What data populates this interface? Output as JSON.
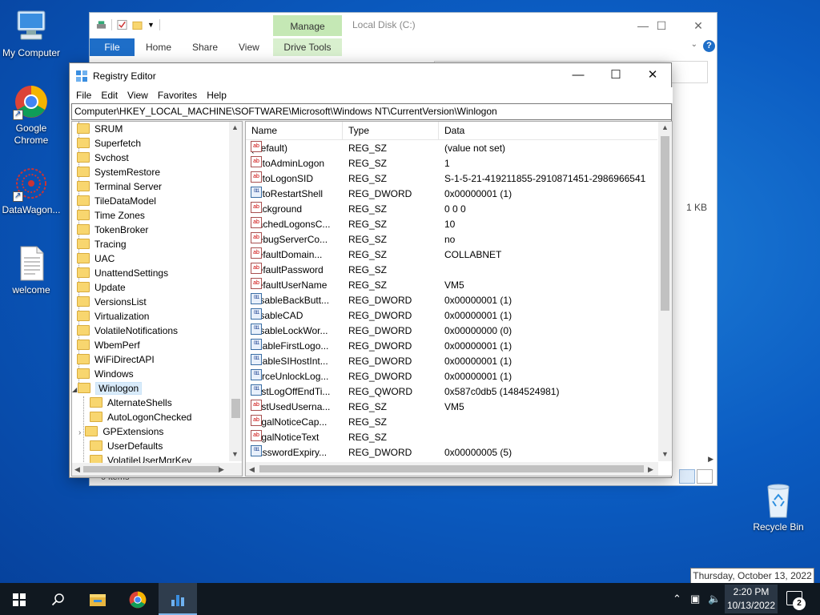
{
  "desktop": {
    "icons": [
      {
        "label": "My Computer"
      },
      {
        "label": "Google Chrome"
      },
      {
        "label": "DataWagon..."
      },
      {
        "label": "welcome"
      }
    ],
    "recycle_bin": "Recycle Bin"
  },
  "explorer": {
    "title": "Local Disk (C:)",
    "manage_tab": "Manage",
    "ribbon_tabs": [
      "File",
      "Home",
      "Share",
      "View",
      "Drive Tools"
    ],
    "size_text": "1 KB",
    "status_text": "0 items",
    "help": "?"
  },
  "regedit": {
    "title": "Registry Editor",
    "menu": [
      "File",
      "Edit",
      "View",
      "Favorites",
      "Help"
    ],
    "address": "Computer\\HKEY_LOCAL_MACHINE\\SOFTWARE\\Microsoft\\Windows NT\\CurrentVersion\\Winlogon",
    "tree": {
      "items": [
        "SRUM",
        "Superfetch",
        "Svchost",
        "SystemRestore",
        "Terminal Server",
        "TileDataModel",
        "Time Zones",
        "TokenBroker",
        "Tracing",
        "UAC",
        "UnattendSettings",
        "Update",
        "VersionsList",
        "Virtualization",
        "VolatileNotifications",
        "WbemPerf",
        "WiFiDirectAPI",
        "Windows",
        "Winlogon"
      ],
      "selected": "Winlogon",
      "children": [
        "AlternateShells",
        "AutoLogonChecked",
        "GPExtensions",
        "UserDefaults",
        "VolatileUserMgrKey"
      ]
    },
    "columns": [
      "Name",
      "Type",
      "Data"
    ],
    "values": [
      {
        "icon": "string",
        "name": "(Default)",
        "type": "REG_SZ",
        "data": "(value not set)"
      },
      {
        "icon": "string",
        "name": "AutoAdminLogon",
        "type": "REG_SZ",
        "data": "1"
      },
      {
        "icon": "string",
        "name": "AutoLogonSID",
        "type": "REG_SZ",
        "data": "S-1-5-21-419211855-2910871451-2986966541"
      },
      {
        "icon": "binary",
        "name": "AutoRestartShell",
        "type": "REG_DWORD",
        "data": "0x00000001 (1)"
      },
      {
        "icon": "string",
        "name": "Background",
        "type": "REG_SZ",
        "data": "0 0 0"
      },
      {
        "icon": "string",
        "name": "CachedLogonsC...",
        "type": "REG_SZ",
        "data": "10"
      },
      {
        "icon": "string",
        "name": "DebugServerCo...",
        "type": "REG_SZ",
        "data": "no"
      },
      {
        "icon": "string",
        "name": "DefaultDomain...",
        "type": "REG_SZ",
        "data": "COLLABNET"
      },
      {
        "icon": "string",
        "name": "DefaultPassword",
        "type": "REG_SZ",
        "data": ""
      },
      {
        "icon": "string",
        "name": "DefaultUserName",
        "type": "REG_SZ",
        "data": "VM5"
      },
      {
        "icon": "binary",
        "name": "DisableBackButt...",
        "type": "REG_DWORD",
        "data": "0x00000001 (1)"
      },
      {
        "icon": "binary",
        "name": "DisableCAD",
        "type": "REG_DWORD",
        "data": "0x00000001 (1)"
      },
      {
        "icon": "binary",
        "name": "DisableLockWor...",
        "type": "REG_DWORD",
        "data": "0x00000000 (0)"
      },
      {
        "icon": "binary",
        "name": "EnableFirstLogo...",
        "type": "REG_DWORD",
        "data": "0x00000001 (1)"
      },
      {
        "icon": "binary",
        "name": "EnableSIHostInt...",
        "type": "REG_DWORD",
        "data": "0x00000001 (1)"
      },
      {
        "icon": "binary",
        "name": "ForceUnlockLog...",
        "type": "REG_DWORD",
        "data": "0x00000001 (1)"
      },
      {
        "icon": "binary",
        "name": "LastLogOffEndTi...",
        "type": "REG_QWORD",
        "data": "0x587c0db5 (1484524981)"
      },
      {
        "icon": "string",
        "name": "LastUsedUserna...",
        "type": "REG_SZ",
        "data": "VM5"
      },
      {
        "icon": "string",
        "name": "LegalNoticeCap...",
        "type": "REG_SZ",
        "data": ""
      },
      {
        "icon": "string",
        "name": "LegalNoticeText",
        "type": "REG_SZ",
        "data": ""
      },
      {
        "icon": "binary",
        "name": "PasswordExpiry...",
        "type": "REG_DWORD",
        "data": "0x00000005 (5)"
      }
    ]
  },
  "tooltip": "Thursday, October 13, 2022",
  "taskbar": {
    "time": "2:20 PM",
    "date": "10/13/2022",
    "notification_count": "2"
  }
}
